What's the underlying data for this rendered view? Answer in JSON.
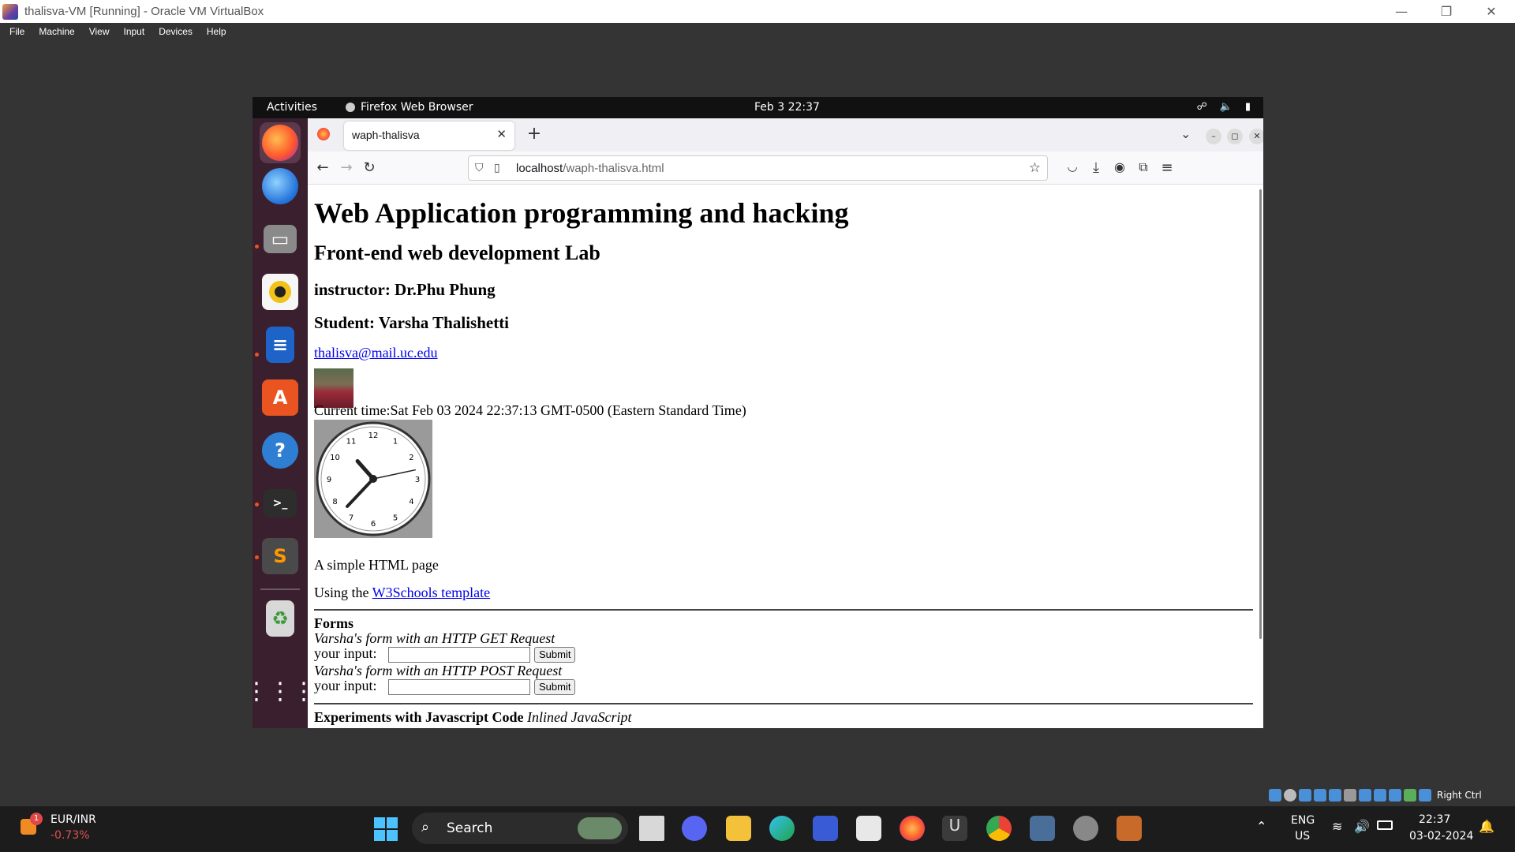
{
  "host": {
    "window_title": "thalisva-VM [Running] - Oracle VM VirtualBox",
    "menu": [
      "File",
      "Machine",
      "View",
      "Input",
      "Devices",
      "Help"
    ],
    "status_text": "Right Ctrl"
  },
  "gnome": {
    "activities": "Activities",
    "app_name": "Firefox Web Browser",
    "clock": "Feb 3  22:37"
  },
  "firefox": {
    "tab_title": "waph-thalisva",
    "url_host": "localhost",
    "url_path": "/waph-thalisva.html"
  },
  "page": {
    "h1": "Web Application programming and hacking",
    "h2": "Front-end web development Lab",
    "instructor": "instructor: Dr.Phu Phung",
    "student": "Student: Varsha Thalishetti",
    "email": "thalisva@mail.uc.edu",
    "current_time": "Current time:Sat Feb 03 2024 22:37:13 GMT-0500 (Eastern Standard Time)",
    "clock_numbers": [
      "12",
      "1",
      "2",
      "3",
      "4",
      "5",
      "6",
      "7",
      "8",
      "9",
      "10",
      "11"
    ],
    "clock_time": {
      "hour": 10,
      "minute": 37,
      "second": 13
    },
    "simple": "A simple HTML page",
    "using_prefix": "Using the ",
    "using_link": "W3Schools template",
    "forms_heading": "Forms",
    "form_get_caption": "Varsha's form with an HTTP GET Request",
    "form_post_caption": "Varsha's form with an HTTP POST Request",
    "input_label": "your input:",
    "submit_label": "Submit",
    "exp_bold": "Experiments with Javascript Code",
    "exp_italic": "Inlined JavaScript"
  },
  "taskbar": {
    "ticker_name": "EUR/INR",
    "ticker_change": "-0.73%",
    "ticker_badge": "1",
    "search_label": "Search",
    "lang_top": "ENG",
    "lang_bottom": "US",
    "time": "22:37",
    "date": "03-02-2024"
  },
  "colors": {
    "dock_bg": "#3a1f2f",
    "ubuntu_orange": "#e95420",
    "link": "#0000ee"
  }
}
